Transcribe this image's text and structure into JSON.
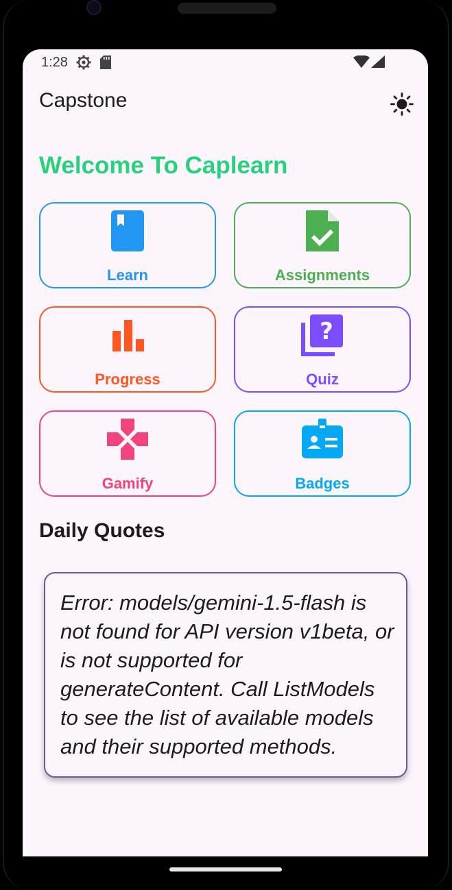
{
  "status_bar": {
    "time": "1:28",
    "icons": [
      "settings-gear-icon",
      "sd-card-icon",
      "wifi-icon",
      "cell-signal-icon"
    ]
  },
  "app_bar": {
    "title": "Capstone",
    "theme_toggle_icon": "sun-icon"
  },
  "welcome_text": "Welcome To Caplearn",
  "tiles": [
    {
      "label": "Learn",
      "icon": "book-icon",
      "color": "#2196F3"
    },
    {
      "label": "Assignments",
      "icon": "assignment-check-icon",
      "color": "#4CAF50"
    },
    {
      "label": "Progress",
      "icon": "bar-chart-icon",
      "color": "#FF5722"
    },
    {
      "label": "Quiz",
      "icon": "quiz-icon",
      "color": "#7C4DFF"
    },
    {
      "label": "Gamify",
      "icon": "gamepad-icon",
      "color": "#F0447A"
    },
    {
      "label": "Badges",
      "icon": "badge-icon",
      "color": "#03A9F4"
    }
  ],
  "daily_quotes": {
    "title": "Daily Quotes",
    "text": "Error: models/gemini-1.5-flash is not found for API version v1beta, or is not supported for generateContent. Call ListModels to see the list of available models and their supported methods."
  },
  "colors": {
    "background": "#FCF5FB",
    "welcome": "#28D17C",
    "quote_border": "#6A5A98"
  }
}
